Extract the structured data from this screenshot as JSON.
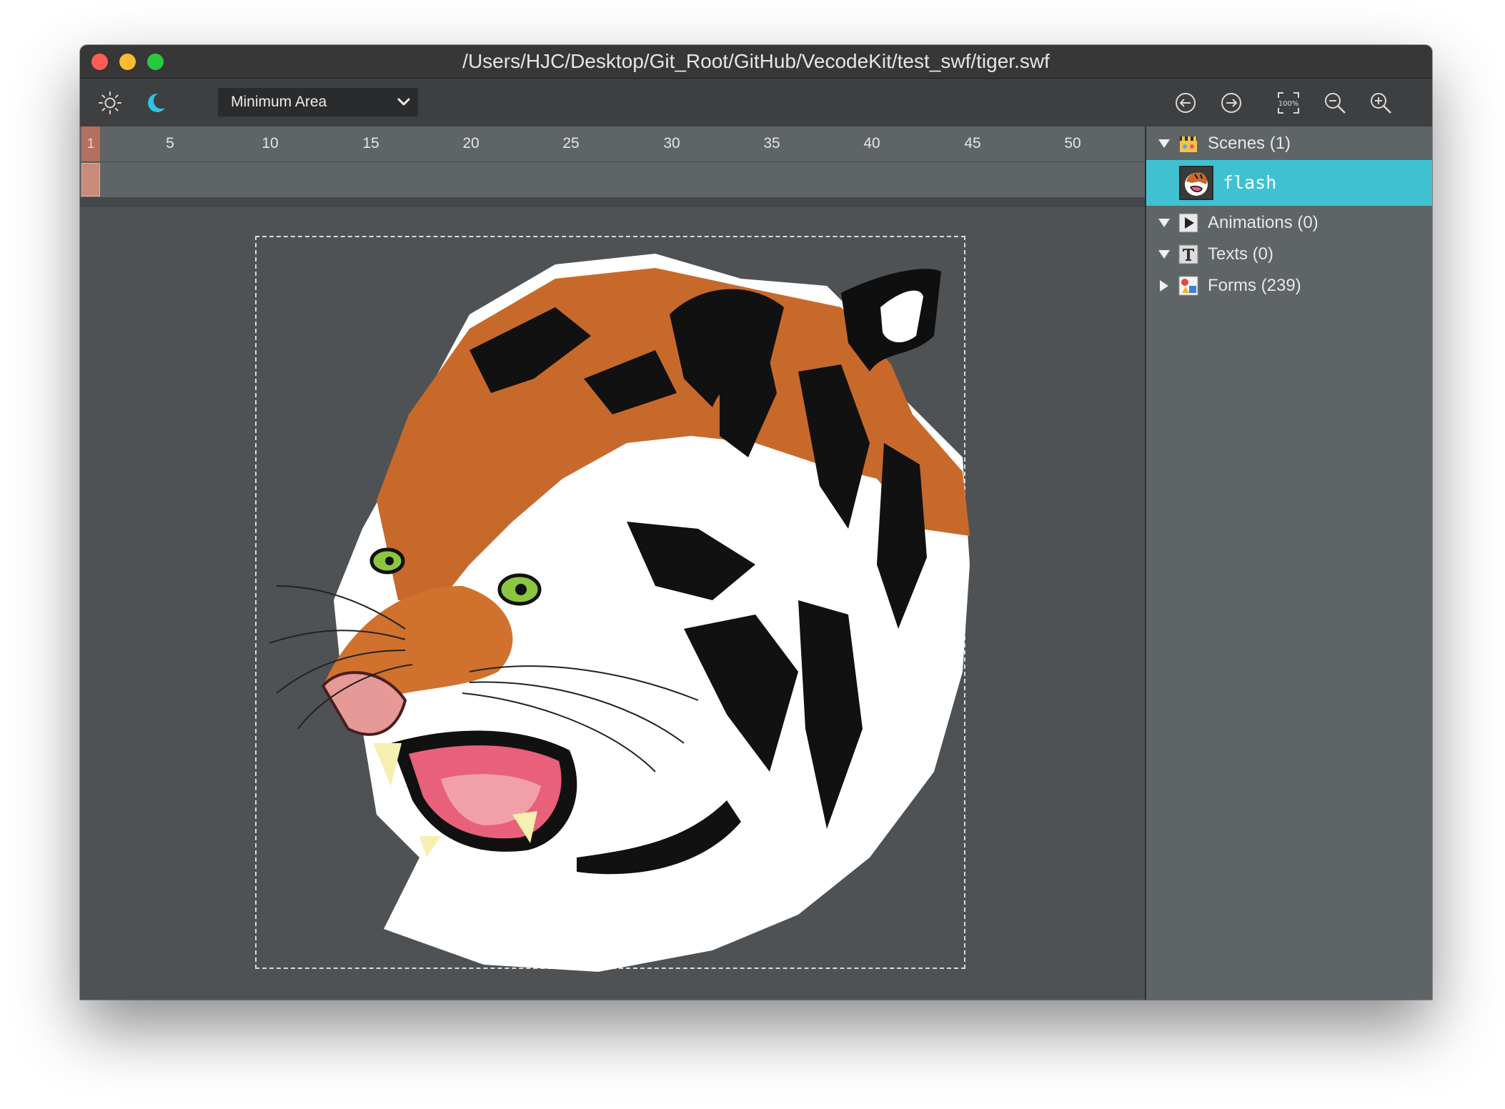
{
  "window": {
    "title": "/Users/HJC/Desktop/Git_Root/GitHub/VecodeKit/test_swf/tiger.swf"
  },
  "traffic_lights": {
    "close": "#fd5d57",
    "minimize": "#fdbb2e",
    "maximize": "#28c940"
  },
  "toolbar": {
    "left_icons": [
      "sun-icon",
      "moon-icon"
    ],
    "display_mode": "Minimum Area",
    "right_icons": [
      "arrow-left-circle-icon",
      "arrow-right-circle-icon",
      "zoom-100-icon",
      "zoom-out-icon",
      "zoom-in-icon"
    ]
  },
  "timeline": {
    "current_frame": "1",
    "ticks": [
      "5",
      "10",
      "15",
      "20",
      "25",
      "30",
      "35",
      "40",
      "45",
      "50"
    ]
  },
  "stage": {
    "content": "tiger-artwork"
  },
  "panel": {
    "accent": "#3fc1d1",
    "scenes_label": "Scenes (1)",
    "scene_item": "flash",
    "animations_label": "Animations (0)",
    "texts_label": "Texts (0)",
    "forms_label": "Forms (239)",
    "icons": [
      "clapperboard-icon",
      "play-icon",
      "text-t-icon",
      "forms-icon"
    ]
  }
}
